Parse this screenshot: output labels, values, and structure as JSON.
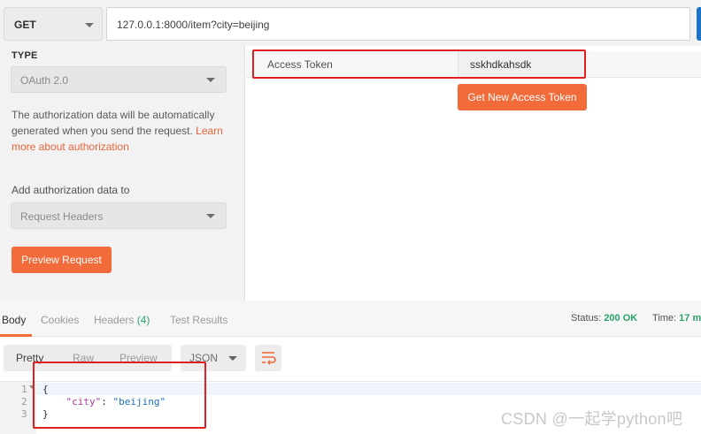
{
  "request": {
    "method": "GET",
    "url": "127.0.0.1:8000/item?city=beijing"
  },
  "auth": {
    "type_label": "TYPE",
    "type_value": "OAuth 2.0",
    "description": "The authorization data will be automatically generated when you send the request. ",
    "learn_more": "Learn more about authorization",
    "add_to_label": "Add authorization data to",
    "add_to_value": "Request Headers",
    "preview_button": "Preview Request",
    "access_token_key": "Access Token",
    "access_token_value": "sskhdkahsdk",
    "get_token_button": "Get New Access Token"
  },
  "response": {
    "tabs": [
      {
        "label": "Body"
      },
      {
        "label": "Cookies"
      },
      {
        "label": "Headers",
        "count": "(4)"
      },
      {
        "label": "Test Results"
      }
    ],
    "status_label": "Status:",
    "status_value": "200 OK",
    "time_label": "Time:",
    "time_value": "17 m",
    "formats": [
      "Pretty",
      "Raw",
      "Preview"
    ],
    "content_type": "JSON",
    "lines": [
      {
        "n": "1",
        "text": "{"
      },
      {
        "n": "2",
        "key": "\"city\"",
        "sep": ": ",
        "val": "\"beijing\""
      },
      {
        "n": "3",
        "text": "}"
      }
    ]
  },
  "watermark": "CSDN @一起学python吧",
  "colors": {
    "accent": "#f26b3a",
    "highlight_box": "#e02020",
    "status_ok": "#2aa36b"
  }
}
